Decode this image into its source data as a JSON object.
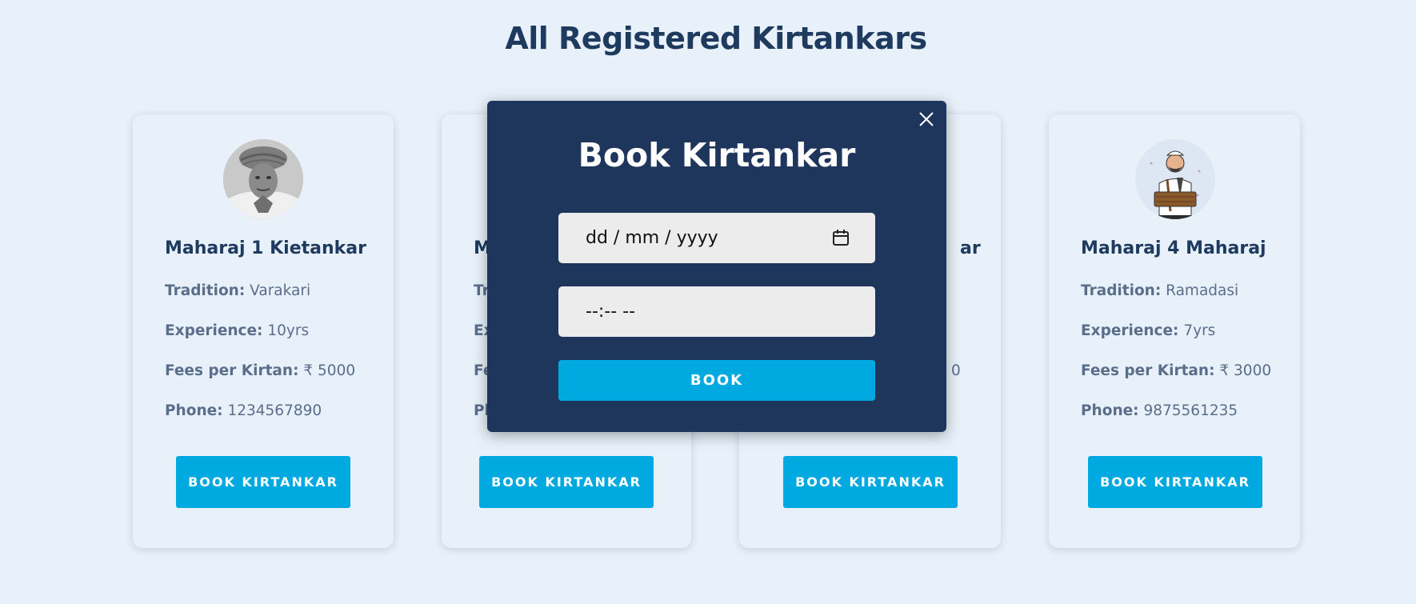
{
  "page": {
    "title": "All Registered Kirtankars"
  },
  "labels": {
    "tradition": "Tradition:",
    "experience": "Experience:",
    "fees": "Fees per Kirtan:",
    "phone": "Phone:",
    "book_button": "BOOK KIRTANKAR"
  },
  "cards": [
    {
      "name": "Maharaj 1 Kietankar",
      "tradition": "Varakari",
      "experience": "10yrs",
      "fees": "₹ 5000",
      "phone": "1234567890",
      "avatar": "portrait-photo"
    },
    {
      "name": "M",
      "tradition": "Tr",
      "experience": "Ex",
      "fees": "Fe",
      "phone": "Pl"
    },
    {
      "name": "ar",
      "fees_tail": "0"
    },
    {
      "name": "Maharaj 4 Maharaj",
      "tradition": "Ramadasi",
      "experience": "7yrs",
      "fees": "₹ 3000",
      "phone": "9875561235",
      "avatar": "harmonium-player-illustration"
    }
  ],
  "modal": {
    "title": "Book Kirtankar",
    "date_placeholder": "dd / mm / yyyy",
    "time_placeholder": "--:-- --",
    "book_label": "BOOK",
    "close_icon": "close-icon",
    "calendar_icon": "calendar-icon"
  },
  "colors": {
    "background": "#e8f1fa",
    "navy": "#1f365c",
    "accent": "#00a9e0",
    "text_muted": "#5a6e8c"
  }
}
